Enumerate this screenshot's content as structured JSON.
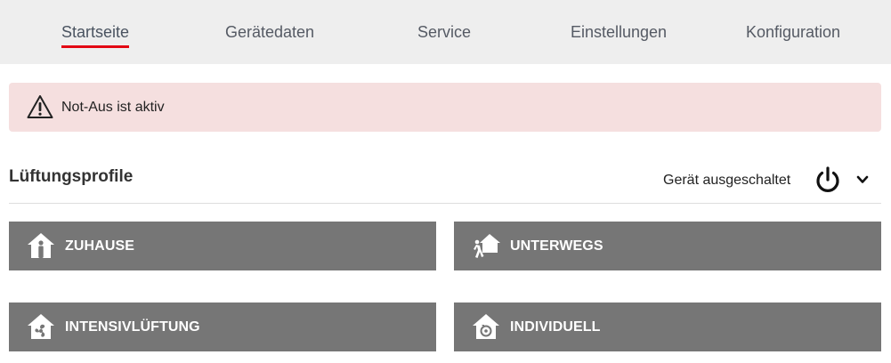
{
  "nav": {
    "tabs": [
      {
        "label": "Startseite",
        "active": true
      },
      {
        "label": "Gerätedaten",
        "active": false
      },
      {
        "label": "Service",
        "active": false
      },
      {
        "label": "Einstellungen",
        "active": false
      },
      {
        "label": "Konfiguration",
        "active": false
      }
    ],
    "active_color": "#e30613"
  },
  "alert": {
    "icon": "warning-icon",
    "message": "Not-Aus ist aktiv",
    "background": "#f5dfdf"
  },
  "profiles": {
    "title": "Lüftungsprofile",
    "device_status": "Gerät ausgeschaltet",
    "power_icon": "power-icon",
    "expand_icon": "chevron-down-icon",
    "buttons": [
      {
        "label": "ZUHAUSE",
        "icon": "home-person-icon"
      },
      {
        "label": "UNTERWEGS",
        "icon": "away-icon"
      },
      {
        "label": "INTENSIVLÜFTUNG",
        "icon": "fan-house-icon"
      },
      {
        "label": "INDIVIDUELL",
        "icon": "custom-house-icon"
      }
    ],
    "button_color": "#767676"
  }
}
